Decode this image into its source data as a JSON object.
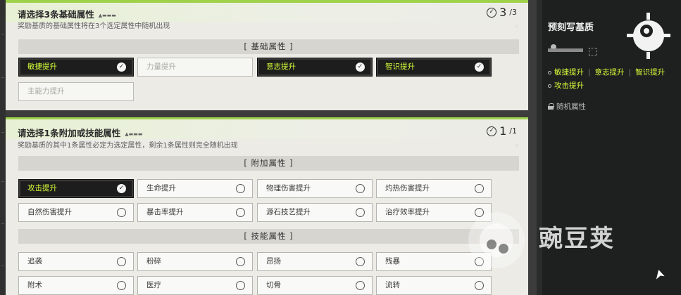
{
  "panel1": {
    "title": "请选择3条基础属性",
    "subtitle": "奖励基质的基础属性将在3个选定属性中随机出现",
    "count": "3",
    "total": "/3",
    "section": "[ 基础属性 ]",
    "chips": [
      {
        "label": "敏捷提升",
        "state": "selected"
      },
      {
        "label": "力量提升",
        "state": "disabled"
      },
      {
        "label": "意志提升",
        "state": "selected"
      },
      {
        "label": "智识提升",
        "state": "selected"
      },
      {
        "label": "主能力提升",
        "state": "disabled"
      }
    ]
  },
  "panel2": {
    "title": "请选择1条附加或技能属性",
    "subtitle": "奖励基质的其中1条属性必定为选定属性，剩余1条属性则完全随机出现",
    "count": "1",
    "total": "/1",
    "section_extra": "[ 附加属性 ]",
    "section_skill": "[ 技能属性 ]",
    "extra_chips": [
      {
        "label": "攻击提升",
        "state": "selected"
      },
      {
        "label": "生命提升",
        "state": "normal"
      },
      {
        "label": "物理伤害提升",
        "state": "normal"
      },
      {
        "label": "灼热伤害提升",
        "state": "normal"
      },
      {
        "label": "自然伤害提升",
        "state": "normal"
      },
      {
        "label": "暴击率提升",
        "state": "normal"
      },
      {
        "label": "源石技艺提升",
        "state": "normal"
      },
      {
        "label": "治疗效率提升",
        "state": "normal"
      }
    ],
    "skill_chips": [
      {
        "label": "追袭",
        "state": "normal"
      },
      {
        "label": "粉碎",
        "state": "normal"
      },
      {
        "label": "昂扬",
        "state": "normal"
      },
      {
        "label": "残暴",
        "state": "normal"
      },
      {
        "label": "附术",
        "state": "normal"
      },
      {
        "label": "医疗",
        "state": "normal"
      },
      {
        "label": "切骨",
        "state": "normal"
      },
      {
        "label": "流转",
        "state": "normal"
      }
    ]
  },
  "side": {
    "title": "预刻写基质",
    "attrs": [
      "敏捷提升",
      "意志提升",
      "智识提升"
    ],
    "attack": "攻击提升",
    "random": "随机属性"
  },
  "watermark": "豌豆荚",
  "colors": {
    "accent_green": "#9fd24a",
    "selected_text": "#d7ff3a",
    "selected_bg": "#1c1d1c",
    "panel_bg": "#ecebe6"
  }
}
